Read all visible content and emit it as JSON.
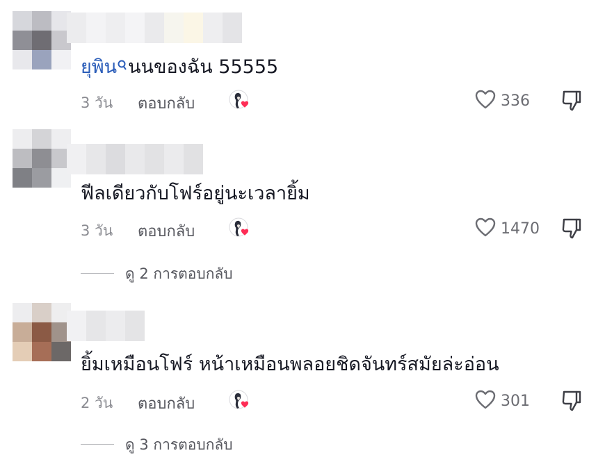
{
  "comments": [
    {
      "mention": "ยุพิน",
      "text": "นนของฉัน 55555",
      "time": "3 วัน",
      "reply_label": "ตอบกลับ",
      "likes": "336",
      "view_replies": ""
    },
    {
      "mention": "",
      "text": "ฟีลเดียวกับโฟร์อยู่นะเวลายิ้ม",
      "time": "3 วัน",
      "reply_label": "ตอบกลับ",
      "likes": "1470",
      "view_replies": "ดู 2 การตอบกลับ"
    },
    {
      "mention": "",
      "text": "ยิ้มเหมือนโฟร์ หน้าเหมือนพลอยชิดจันทร์สมัยล่ะอ่อน",
      "time": "2 วัน",
      "reply_label": "ตอบกลับ",
      "likes": "301",
      "view_replies": "ดู 3 การตอบกลับ"
    }
  ],
  "icons": {
    "like": "heart-outline-icon",
    "dislike": "thumbs-down-icon",
    "creator_like": "creator-liked-heart-icon",
    "mention": "search-icon"
  },
  "colors": {
    "mention": "#2b5db9",
    "heart": "#fe2c55",
    "meta": "#8a8b91"
  }
}
